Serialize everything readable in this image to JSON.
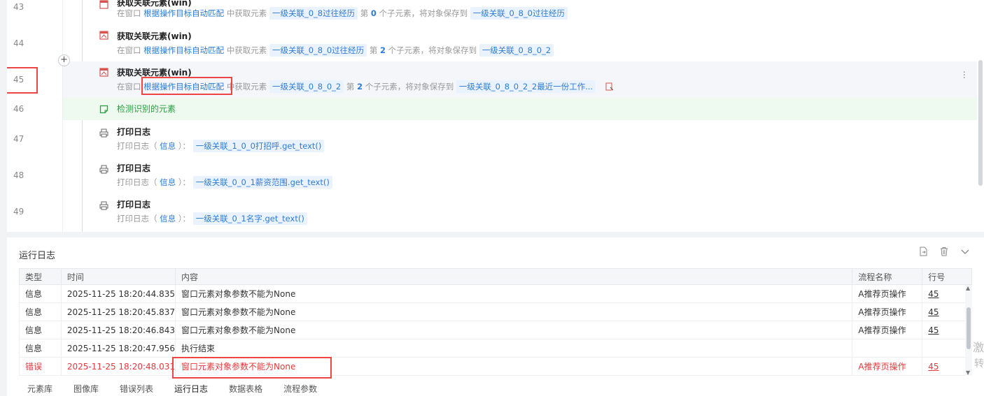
{
  "editor": {
    "line_numbers": [
      "43",
      "44",
      "45",
      "46",
      "47",
      "48",
      "49"
    ],
    "rows": [
      {
        "title": "获取关联元素(win)",
        "prefix": "在窗口",
        "win": "根据操作目标自动匹配",
        "mid": "中获取元素",
        "src": "一级关联_0_8过往经历",
        "idx_pre": "第",
        "idx": "0",
        "idx_post": "个子元素，将对象保存到",
        "dst": "一级关联_0_8_0过往经历"
      },
      {
        "title": "获取关联元素(win)",
        "prefix": "在窗口",
        "win": "根据操作目标自动匹配",
        "mid": "中获取元素",
        "src": "一级关联_0_8_0过往经历",
        "idx_pre": "第",
        "idx": "2",
        "idx_post": "个子元素，将对象保存到",
        "dst": "一级关联_0_8_0_2"
      },
      {
        "title": "获取关联元素(win)",
        "prefix": "在窗口",
        "win": "根据操作目标自动匹配",
        "mid": "中获取元素",
        "src": "一级关联_0_8_0_2",
        "idx_pre": "第",
        "idx": "2",
        "idx_post": "个子元素，将对象保存到",
        "dst": "一级关联_0_8_0_2_2最近一份工作..."
      }
    ],
    "detect_label": "检测识别的元素",
    "logs": [
      {
        "title": "打印日志",
        "prefix": "打印日志（",
        "level": "信息",
        "sep": "）：",
        "expr": "一级关联_1_0_0打招呼.get_text()"
      },
      {
        "title": "打印日志",
        "prefix": "打印日志（",
        "level": "信息",
        "sep": "）：",
        "expr": "一级关联_0_0_1薪资范围.get_text()"
      },
      {
        "title": "打印日志",
        "prefix": "打印日志（",
        "level": "信息",
        "sep": "）：",
        "expr": "一级关联_0_1名字.get_text()"
      }
    ],
    "add_button": "+"
  },
  "log_panel": {
    "title": "运行日志",
    "columns": [
      "类型",
      "时间",
      "内容",
      "流程名称",
      "行号"
    ],
    "rows": [
      {
        "type": "信息",
        "time": "2025-11-25 18:20:44.835",
        "content": "窗口元素对象参数不能为None",
        "flow": "A推荐页操作",
        "line": "45"
      },
      {
        "type": "信息",
        "time": "2025-11-25 18:20:45.837",
        "content": "窗口元素对象参数不能为None",
        "flow": "A推荐页操作",
        "line": "45"
      },
      {
        "type": "信息",
        "time": "2025-11-25 18:20:46.843",
        "content": "窗口元素对象参数不能为None",
        "flow": "A推荐页操作",
        "line": "45"
      },
      {
        "type": "信息",
        "time": "2025-11-25 18:20:47.956",
        "content": "执行结束",
        "flow": "",
        "line": ""
      },
      {
        "type": "错误",
        "time": "2025-11-25 18:20:48.031",
        "content": "窗口元素对象参数不能为None",
        "flow": "A推荐页操作",
        "line": "45"
      }
    ]
  },
  "bottom_tabs": [
    "元素库",
    "图像库",
    "错误列表",
    "运行日志",
    "数据表格",
    "流程参数"
  ],
  "watermark": [
    "激",
    "转"
  ],
  "colors": {
    "link": "#2d7bd6",
    "error": "#e4393c",
    "highlight_box": "#ee4444",
    "success": "#2a9e3f"
  }
}
